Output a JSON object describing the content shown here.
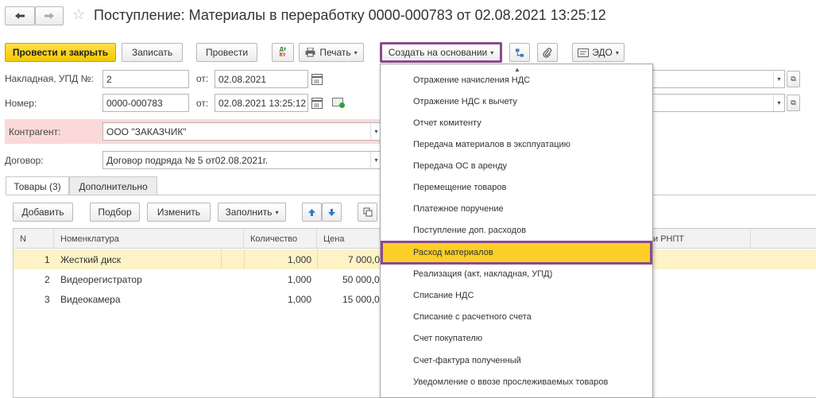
{
  "window": {
    "title": "Поступление: Материалы в переработку 0000-000783 от 02.08.2021 13:25:12",
    "back_icon": "arrow-left-icon",
    "forward_icon": "arrow-right-icon",
    "favorite_icon": "star-icon"
  },
  "toolbar": {
    "post_and_close": "Провести и закрыть",
    "save": "Записать",
    "post": "Провести",
    "dt_kt_icon": "dt-kt-icon",
    "print": "Печать",
    "create_based_on": "Создать на основании",
    "edo": "ЭДО"
  },
  "form": {
    "invoice_label": "Накладная, УПД №:",
    "invoice_number": "2",
    "invoice_from_label": "от:",
    "invoice_date": "02.08.2021",
    "number_label": "Номер:",
    "number": "0000-000783",
    "number_from_label": "от:",
    "number_date": "02.08.2021 13:25:12",
    "counterparty_label": "Контрагент:",
    "counterparty": "ООО \"ЗАКАЗЧИК\"",
    "contract_label": "Договор:",
    "contract": "Договор подряда № 5 от02.08.2021г."
  },
  "tabs": [
    {
      "label": "Товары (3)"
    },
    {
      "label": "Дополнительно"
    }
  ],
  "table_toolbar": {
    "add": "Добавить",
    "select": "Подбор",
    "edit": "Изменить",
    "fill": "Заполнить"
  },
  "table": {
    "headers": [
      "N",
      "Номенклатура",
      "Количество",
      "Цена"
    ],
    "extra_header": "и РНПТ",
    "rows": [
      {
        "n": "1",
        "name": "Жесткий диск",
        "qty": "1,000",
        "price": "7 000,0"
      },
      {
        "n": "2",
        "name": "Видеорегистратор",
        "qty": "1,000",
        "price": "50 000,0"
      },
      {
        "n": "3",
        "name": "Видеокамера",
        "qty": "1,000",
        "price": "15 000,0"
      }
    ]
  },
  "menu": {
    "items": [
      "Отражение начисления НДС",
      "Отражение НДС к вычету",
      "Отчет комитенту",
      "Передача материалов в эксплуатацию",
      "Передача ОС в аренду",
      "Перемещение товаров",
      "Платежное поручение",
      "Поступление доп. расходов",
      "Расход материалов",
      "Реализация (акт, накладная, УПД)",
      "Списание НДС",
      "Списание с расчетного счета",
      "Счет покупателю",
      "Счет-фактура полученный",
      "Уведомление о ввозе прослеживаемых товаров"
    ],
    "selected_index": 8
  },
  "colors": {
    "primary_button": "#f5c800",
    "highlight_border": "#8b4a8c",
    "selected_row": "#fdf3c7",
    "counterparty_bg": "#fbd9d9"
  }
}
